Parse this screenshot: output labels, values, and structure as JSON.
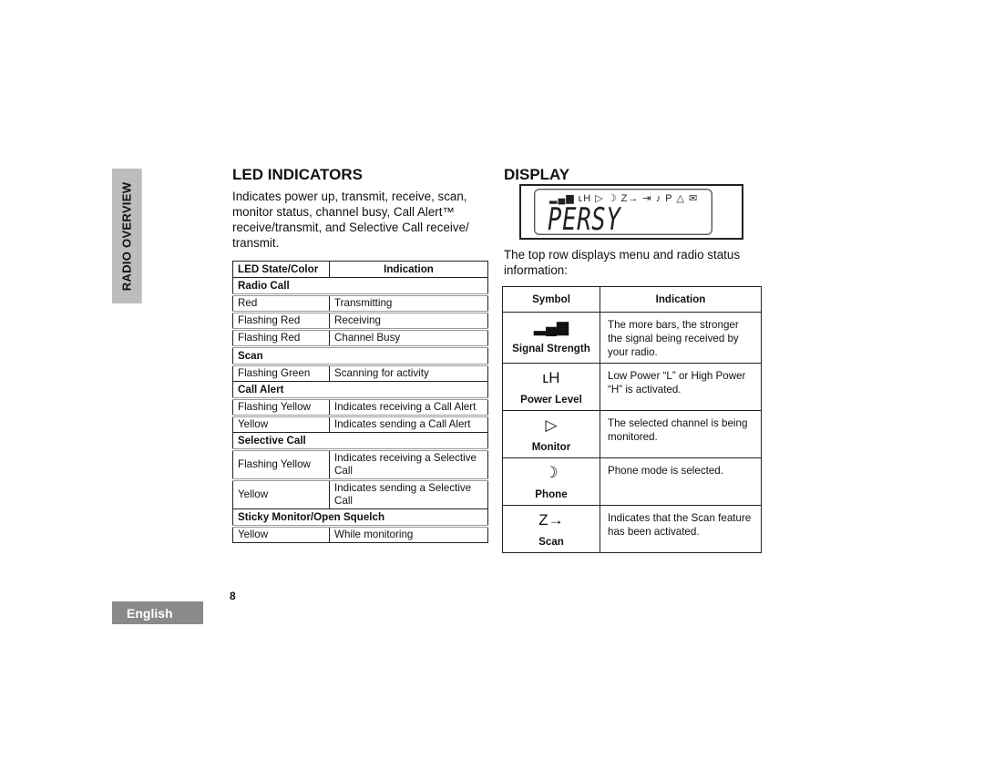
{
  "side_tab": {
    "label": "RADIO OVERVIEW"
  },
  "language_tab": {
    "label": "English"
  },
  "page_number": "8",
  "led_section": {
    "title": "LED INDICATORS",
    "intro": "Indicates power up, transmit, receive, scan, monitor status, channel busy, Call Alert™ receive/transmit, and Selective Call receive/ transmit.",
    "table": {
      "headers": [
        "LED State/Color",
        "Indication"
      ],
      "sections": [
        {
          "name": "Radio Call",
          "rows": [
            {
              "state": "Red",
              "indication": "Transmitting"
            },
            {
              "state": "Flashing Red",
              "indication": "Receiving"
            },
            {
              "state": "Flashing Red",
              "indication": "Channel Busy"
            }
          ]
        },
        {
          "name": "Scan",
          "rows": [
            {
              "state": "Flashing Green",
              "indication": "Scanning for activity"
            }
          ]
        },
        {
          "name": "Call Alert",
          "rows": [
            {
              "state": "Flashing Yellow",
              "indication": "Indicates receiving a Call Alert"
            },
            {
              "state": "Yellow",
              "indication": "Indicates sending a Call Alert"
            }
          ]
        },
        {
          "name": "Selective Call",
          "rows": [
            {
              "state": "Flashing Yellow",
              "indication": "Indicates receiving a Selective Call"
            },
            {
              "state": "Yellow",
              "indication": "Indicates sending a Selective Call"
            }
          ]
        },
        {
          "name": "Sticky Monitor/Open Squelch",
          "rows": [
            {
              "state": "Yellow",
              "indication": "While monitoring"
            }
          ]
        }
      ]
    }
  },
  "display_section": {
    "title": "DISPLAY",
    "lcd": {
      "icons": "▂▄▆ ʟH ▷ ☽ Z→ ⇥ ♪ P △ ✉",
      "text": "PERSY"
    },
    "intro": "The top row displays menu and radio status information:",
    "table": {
      "headers": [
        "Symbol",
        "Indication"
      ],
      "rows": [
        {
          "icon": "signal-strength-icon",
          "glyph": "▂▄▆",
          "label": "Signal Strength",
          "indication": "The more bars, the stronger the signal being received by your radio."
        },
        {
          "icon": "power-level-icon",
          "glyph": "ʟH",
          "label": "Power Level",
          "indication": "Low Power “L” or High Power “H” is activated."
        },
        {
          "icon": "monitor-icon",
          "glyph": "▷",
          "label": "Monitor",
          "indication": "The selected channel is being monitored."
        },
        {
          "icon": "phone-icon",
          "glyph": "☽",
          "label": "Phone",
          "indication": "Phone mode is selected."
        },
        {
          "icon": "scan-icon",
          "glyph": "Z→",
          "label": "Scan",
          "indication": "Indicates that the Scan feature has been activated."
        }
      ]
    }
  }
}
